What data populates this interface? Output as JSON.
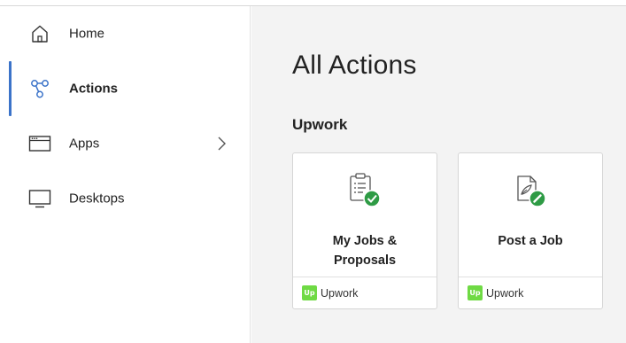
{
  "sidebar": {
    "items": [
      {
        "label": "Home",
        "icon": "home-icon"
      },
      {
        "label": "Actions",
        "icon": "actions-icon",
        "active": true
      },
      {
        "label": "Apps",
        "icon": "apps-icon",
        "has_submenu": true
      },
      {
        "label": "Desktops",
        "icon": "desktop-icon"
      }
    ]
  },
  "main": {
    "title": "All Actions",
    "section_title": "Upwork",
    "cards": [
      {
        "label_line1": "My Jobs &",
        "label_line2": "Proposals",
        "footer": "Upwork",
        "logo_text": "Up"
      },
      {
        "label_line1": "Post a Job",
        "footer": "Upwork",
        "logo_text": "Up"
      }
    ]
  },
  "colors": {
    "accent": "#3b73c9",
    "upwork_green": "#6fda44",
    "check_green": "#2e9b45",
    "main_bg": "#f3f3f3"
  }
}
